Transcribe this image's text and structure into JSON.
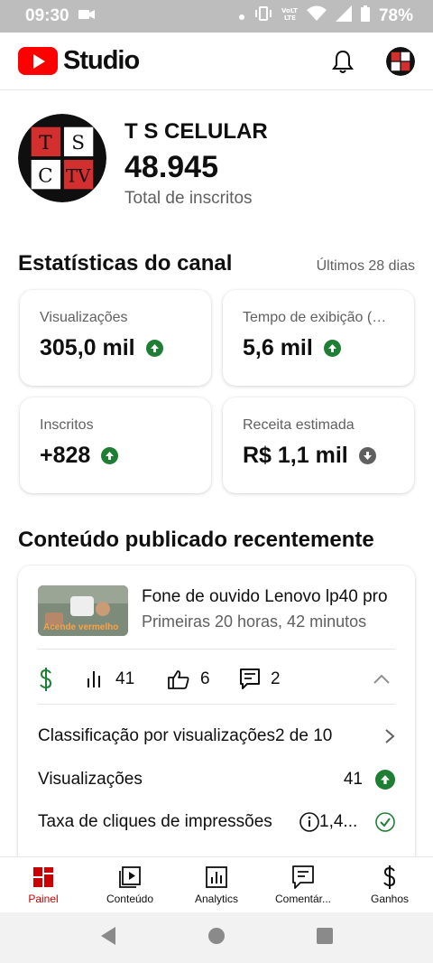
{
  "status_bar": {
    "time": "09:30",
    "battery": "78%"
  },
  "header": {
    "logo_text": "Studio",
    "bell_icon": "bell-icon"
  },
  "channel": {
    "name": "T S CELULAR",
    "subscribers": "48.945",
    "subscribers_label": "Total de inscritos",
    "avatar_letters": [
      "T",
      "S",
      "C",
      "TV"
    ]
  },
  "stats": {
    "title": "Estatísticas do canal",
    "period": "Últimos 28 dias",
    "cards": [
      {
        "label": "Visualizações",
        "value": "305,0 mil",
        "trend": "up"
      },
      {
        "label": "Tempo de exibição (horas)",
        "value": "5,6 mil",
        "trend": "up"
      },
      {
        "label": "Inscritos",
        "value": "+828",
        "trend": "up"
      },
      {
        "label": "Receita estimada",
        "value": "R$ 1,1 mil",
        "trend": "down"
      }
    ]
  },
  "recent": {
    "title": "Conteúdo publicado recentemente",
    "video": {
      "thumb_caption": "Acende vermelho",
      "title": "Fone de ouvido  Lenovo lp40 pro",
      "meta": "Primeiras 20 horas, 42 minutos"
    },
    "metrics": {
      "views": "41",
      "likes": "6",
      "comments": "2"
    },
    "rows": [
      {
        "label": "Classificação por visualizações",
        "value": "2 de 10"
      },
      {
        "label": "Visualizações",
        "value": "41"
      },
      {
        "label": "Taxa de cliques de impressões",
        "value": "1,4..."
      }
    ]
  },
  "bottom_nav": [
    {
      "label": "Painel",
      "icon": "dashboard-icon",
      "active": true
    },
    {
      "label": "Conteúdo",
      "icon": "content-icon",
      "active": false
    },
    {
      "label": "Analytics",
      "icon": "analytics-icon",
      "active": false
    },
    {
      "label": "Comentár...",
      "icon": "comments-icon",
      "active": false
    },
    {
      "label": "Ganhos",
      "icon": "earnings-icon",
      "active": false
    }
  ],
  "colors": {
    "accent": "#cc0000",
    "up": "#1e7e34",
    "down": "#606060",
    "money": "#1e7e34"
  }
}
